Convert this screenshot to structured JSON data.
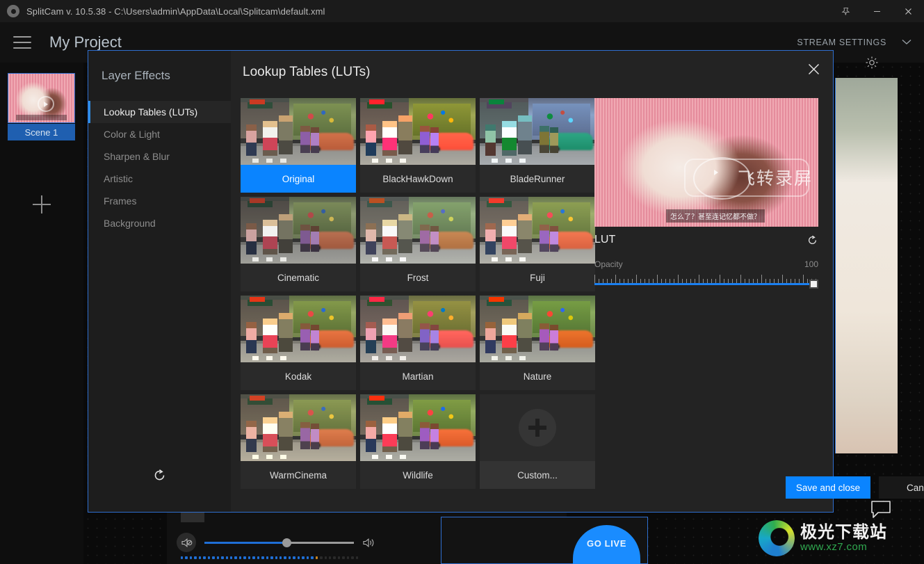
{
  "titlebar": {
    "app_title": "SplitCam v. 10.5.38 - C:\\Users\\admin\\AppData\\Local\\Splitcam\\default.xml",
    "pin_icon": "pin-icon",
    "minimize_icon": "minimize-icon",
    "close_icon": "close-icon"
  },
  "header": {
    "menu_icon": "hamburger-menu-icon",
    "project_title": "My Project",
    "stream_settings_label": "STREAM SETTINGS",
    "chevron_icon": "chevron-down-icon"
  },
  "scenes": {
    "scene_label": "Scene 1",
    "add_icon": "plus-icon"
  },
  "stage": {
    "brightness_icon": "brightness-icon",
    "chat_icon": "chat-bubble-icon"
  },
  "bottom": {
    "mute_icon": "speaker-mute-icon",
    "speaker_icon": "speaker-icon",
    "volume_value": 55,
    "go_live_label": "GO LIVE"
  },
  "watermark": {
    "cn_text": "极光下载站",
    "url_text": "www.xz7.com"
  },
  "dialog": {
    "panel_title": "Layer Effects",
    "content_title": "Lookup Tables (LUTs)",
    "close_icon": "close-icon",
    "reset_icon": "reset-icon",
    "menu": [
      {
        "label": "Lookup Tables (LUTs)",
        "active": true
      },
      {
        "label": "Color & Light",
        "active": false
      },
      {
        "label": "Sharpen & Blur",
        "active": false
      },
      {
        "label": "Artistic",
        "active": false
      },
      {
        "label": "Frames",
        "active": false
      },
      {
        "label": "Background",
        "active": false
      }
    ],
    "luts": [
      {
        "label": "Original",
        "selected": true,
        "filter": "f-original"
      },
      {
        "label": "BlackHawkDown",
        "selected": false,
        "filter": "f-blackhawk"
      },
      {
        "label": "BladeRunner",
        "selected": false,
        "filter": "f-bladerunner"
      },
      {
        "label": "Cinematic",
        "selected": false,
        "filter": "f-cinematic"
      },
      {
        "label": "Frost",
        "selected": false,
        "filter": "f-frost"
      },
      {
        "label": "Fuji",
        "selected": false,
        "filter": "f-fuji"
      },
      {
        "label": "Kodak",
        "selected": false,
        "filter": "f-kodak"
      },
      {
        "label": "Martian",
        "selected": false,
        "filter": "f-martian"
      },
      {
        "label": "Nature",
        "selected": false,
        "filter": "f-nature"
      },
      {
        "label": "WarmCinema",
        "selected": false,
        "filter": "f-warmcinema"
      },
      {
        "label": "Wildlife",
        "selected": false,
        "filter": "f-wildlife"
      },
      {
        "label": "Custom...",
        "selected": false,
        "filter": "custom"
      }
    ],
    "preview": {
      "watermark_text": "飞转录屏",
      "subtitle_text": "怎么了？甚至连记忆都不做？"
    },
    "lut_section_title": "LUT",
    "lut_reset_icon": "reset-icon",
    "opacity_label": "Opacity",
    "opacity_value": "100",
    "save_label": "Save and close",
    "cancel_label": "Cancel"
  },
  "colors": {
    "accent_blue": "#0a84ff",
    "dialog_border": "#2f6fd0",
    "panel_bg": "#232323",
    "sidebar_bg": "#1d1d1d"
  }
}
